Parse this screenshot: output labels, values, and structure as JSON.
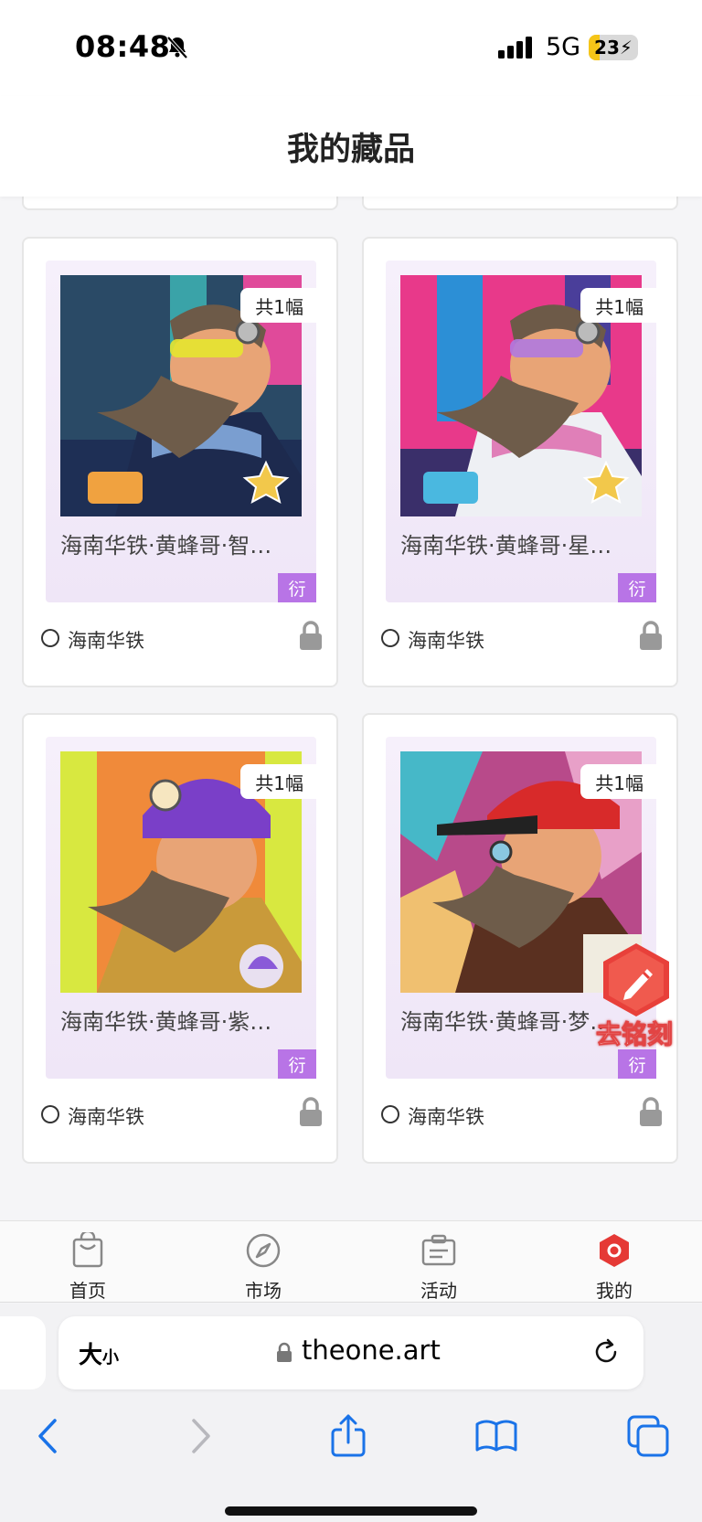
{
  "status_bar": {
    "time": "08:48",
    "network": "5G",
    "battery": "23",
    "battery_level": 0.23,
    "silent_mode": true
  },
  "header": {
    "title": "我的藏品"
  },
  "cards": [
    {
      "name": "海南华铁·黄蜂哥·智…",
      "count_label": "共1幅",
      "tag": "衍",
      "issuer": "海南华铁",
      "locked": true
    },
    {
      "name": "海南华铁·黄蜂哥·星…",
      "count_label": "共1幅",
      "tag": "衍",
      "issuer": "海南华铁",
      "locked": true
    },
    {
      "name": "海南华铁·黄蜂哥·紫…",
      "count_label": "共1幅",
      "tag": "衍",
      "issuer": "海南华铁",
      "locked": true
    },
    {
      "name": "海南华铁·黄蜂哥·梦…",
      "count_label": "共1幅",
      "tag": "衍",
      "issuer": "海南华铁",
      "locked": true
    }
  ],
  "floating_button": {
    "label": "去铭刻"
  },
  "tab_bar": {
    "items": [
      {
        "label": "首页",
        "icon": "bag-icon",
        "active": false
      },
      {
        "label": "市场",
        "icon": "compass-icon",
        "active": false
      },
      {
        "label": "活动",
        "icon": "ticket-icon",
        "active": false
      },
      {
        "label": "我的",
        "icon": "profile-hex-icon",
        "active": true
      }
    ]
  },
  "browser": {
    "text_size_label": "大",
    "text_size_small": "小",
    "url": "theone.art",
    "toolbar": [
      "back-icon",
      "forward-icon",
      "share-icon",
      "bookmarks-icon",
      "tabs-icon"
    ]
  },
  "colors": {
    "accent_tag": "#b874e6",
    "active_tab": "#e53935",
    "link_blue": "#1a73e8"
  }
}
